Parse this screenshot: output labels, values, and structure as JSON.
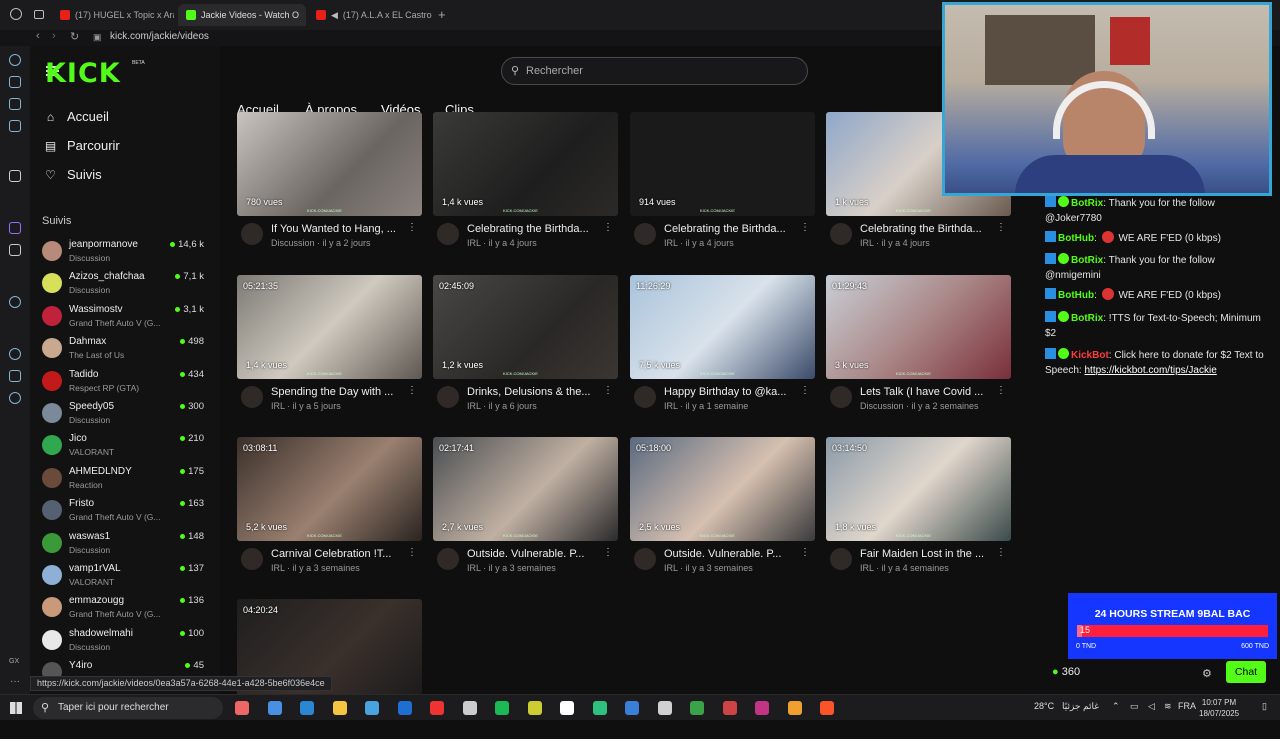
{
  "browser": {
    "tabs": [
      {
        "label": "(17) HUGEL x Topic x Ara",
        "color": "#e62117"
      },
      {
        "label": "Jackie Videos - Watch O",
        "color": "#53fc18"
      },
      {
        "label": "(17) A.L.A x EL Castro",
        "color": "#e62117"
      }
    ],
    "new_tab": "+",
    "url": "kick.com/jackie/videos"
  },
  "sidebar": {
    "beta": "BETA",
    "nav": [
      {
        "label": "Accueil",
        "icon": "home-icon",
        "glyph": "⌂"
      },
      {
        "label": "Parcourir",
        "icon": "browse-icon",
        "glyph": "▤"
      },
      {
        "label": "Suivis",
        "icon": "heart-icon",
        "glyph": "♡"
      }
    ],
    "following_title": "Suivis",
    "following": [
      {
        "name": "jeanpormanove",
        "game": "Discussion",
        "viewers": "14,6 k",
        "color": "#b78a7a"
      },
      {
        "name": "Azizos_chafchaa",
        "game": "Discussion",
        "viewers": "7,1 k",
        "color": "#d6e05a"
      },
      {
        "name": "Wassimostv",
        "game": "Grand Theft Auto V (G...",
        "viewers": "3,1 k",
        "color": "#c0213b"
      },
      {
        "name": "Dahmax",
        "game": "The Last of Us",
        "viewers": "498",
        "color": "#c8a98f"
      },
      {
        "name": "Tadido",
        "game": "Respect RP (GTA)",
        "viewers": "434",
        "color": "#c21a1a"
      },
      {
        "name": "Speedy05",
        "game": "Discussion",
        "viewers": "300",
        "color": "#7a8a9a"
      },
      {
        "name": "Jico",
        "game": "VALORANT",
        "viewers": "210",
        "color": "#2fa84f"
      },
      {
        "name": "AHMEDLNDY",
        "game": "Reaction",
        "viewers": "175",
        "color": "#6a4a3a"
      },
      {
        "name": "Fristo",
        "game": "Grand Theft Auto V (G...",
        "viewers": "163",
        "color": "#556070"
      },
      {
        "name": "waswas1",
        "game": "Discussion",
        "viewers": "148",
        "color": "#3a9a3a"
      },
      {
        "name": "vamp1rVAL",
        "game": "VALORANT",
        "viewers": "137",
        "color": "#8fb0d6"
      },
      {
        "name": "emmazougg",
        "game": "Grand Theft Auto V (G...",
        "viewers": "136",
        "color": "#c99a7a"
      },
      {
        "name": "shadowelmahi",
        "game": "Discussion",
        "viewers": "100",
        "color": "#e8e8e8"
      },
      {
        "name": "Y4iro",
        "game": "",
        "viewers": "45",
        "color": "#555"
      }
    ]
  },
  "search": {
    "placeholder": "Rechercher"
  },
  "channel_tabs": [
    "Accueil",
    "À propos",
    "Vidéos",
    "Clips"
  ],
  "watermark": "KICK.COM/JACKIE",
  "videos": [
    {
      "duration": "",
      "views": "780 vues",
      "title": "If You Wanted to Hang, ...",
      "meta": "Discussion · il y a 2 jours",
      "bg": "linear-gradient(135deg,#c9c4c0,#6b6561 60%,#8a8380)"
    },
    {
      "duration": "",
      "views": "1,4 k vues",
      "title": "Celebrating the Birthda...",
      "meta": "IRL · il y a 4 jours",
      "bg": "linear-gradient(135deg,#3a3a38,#1e1e1e 60%,#2c2a28)"
    },
    {
      "duration": "",
      "views": "914 vues",
      "title": "Celebrating the Birthda...",
      "meta": "IRL · il y a 4 jours",
      "bg": "#1a1a1a"
    },
    {
      "duration": "",
      "views": "1 k vues",
      "title": "Celebrating the Birthda...",
      "meta": "IRL · il y a 4 jours",
      "bg": "linear-gradient(135deg,#8fa7c9,#d8d0c8 50%,#6a5a4f)"
    },
    {
      "duration": "05:21:35",
      "views": "1,4 k vues",
      "title": "Spending the Day with ...",
      "meta": "IRL · il y a 5 jours",
      "bg": "linear-gradient(135deg,#7c7a74,#cfc9bf 50%,#5e5852)"
    },
    {
      "duration": "02:45:09",
      "views": "1,2 k vues",
      "title": "Drinks, Delusions & the...",
      "meta": "IRL · il y a 6 jours",
      "bg": "linear-gradient(135deg,#4a4845,#2a2826 60%,#3a3633)"
    },
    {
      "duration": "11:26:29",
      "views": "7,5 k vues",
      "title": "Happy Birthday to @ka...",
      "meta": "IRL · il y a 1 semaine",
      "bg": "linear-gradient(135deg,#a9c3dc,#d9e2ea 50%,#3a4a6a)"
    },
    {
      "duration": "01:29:43",
      "views": "3 k vues",
      "title": "Lets Talk (I have Covid ...",
      "meta": "Discussion · il y a 2 semaines",
      "bg": "linear-gradient(135deg,#c8cfd6,#a88 50%,#7a2f3a)"
    },
    {
      "duration": "03:08:11",
      "views": "5,2 k vues",
      "title": "Carnival Celebration !T...",
      "meta": "IRL · il y a 3 semaines",
      "bg": "linear-gradient(135deg,#3a302a,#9a8070 55%,#2a2420)"
    },
    {
      "duration": "02:17:41",
      "views": "2,7 k vues",
      "title": "Outside. Vulnerable. P...",
      "meta": "IRL · il y a 3 semaines",
      "bg": "linear-gradient(135deg,#4a4e52,#c0b0a2 55%,#2a2a2c)"
    },
    {
      "duration": "05:18:00",
      "views": "2,5 k vues",
      "title": "Outside. Vulnerable. P...",
      "meta": "IRL · il y a 3 semaines",
      "bg": "linear-gradient(135deg,#5a6a80,#d6c0b0 55%,#3a3a3c)"
    },
    {
      "duration": "03:14:50",
      "views": "1,8 k vues",
      "title": "Fair Maiden Lost in the ...",
      "meta": "IRL · il y a 4 semaines",
      "bg": "linear-gradient(135deg,#8a9aa8,#e0d6cc 50%,#3a4a4a)"
    },
    {
      "duration": "04:20:24",
      "views": "",
      "title": "",
      "meta": "",
      "bg": "linear-gradient(135deg,#1e1e1e,#3a302c 55%,#1a1a1a)"
    }
  ],
  "chat": {
    "messages": [
      {
        "user": "BotRix",
        "cls": "bot",
        "sep": ":",
        "text": "Thank you for the follow @Joker7780",
        "badge": "verified",
        "no": false
      },
      {
        "user": "BotHub",
        "cls": "bot",
        "sep": ":",
        "text": "WE ARE F'ED (0 kbps)",
        "badge": "",
        "no": true
      },
      {
        "user": "BotRix",
        "cls": "bot",
        "sep": ":",
        "text": "Thank you for the follow @nmigemini",
        "badge": "verified",
        "no": false
      },
      {
        "user": "BotHub",
        "cls": "bot",
        "sep": ":",
        "text": "WE ARE F'ED (0 kbps)",
        "badge": "",
        "no": true
      },
      {
        "user": "BotRix",
        "cls": "bot",
        "sep": ":",
        "text": "!TTS for Text-to-Speech; Minimum $2",
        "badge": "verified",
        "no": false
      },
      {
        "user": "KickBot",
        "cls": "botr",
        "sep": ":",
        "text": "Click here to donate for $2 Text to Speech:",
        "link": "https://kickbot.com/tips/Jackie",
        "badge": "verified",
        "no": false
      }
    ],
    "points": "360",
    "button": "Chat"
  },
  "donation": {
    "title": "24 HOURS STREAM 9BAL BAC",
    "value": "15",
    "min": "0 TND",
    "max": "600 TND",
    "progress": 0.025
  },
  "status_url": "https://kick.com/jackie/videos/0ea3a57a-6268-44e1-a428-5be6f036e4ce",
  "taskbar": {
    "search": "Taper ici pour rechercher",
    "temp": "28°C",
    "weather": "غائم جزئيًا",
    "lang": "FRA",
    "time": "10:07 PM",
    "date": "18/07/2025"
  }
}
